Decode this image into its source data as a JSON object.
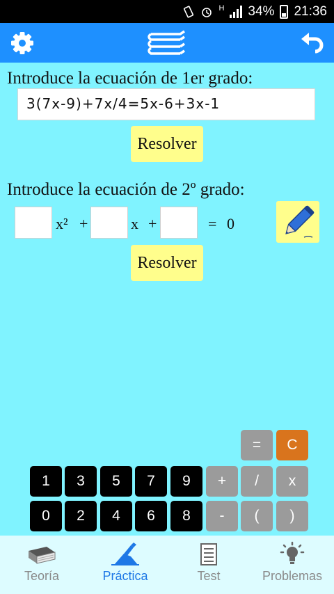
{
  "status_bar": {
    "battery": "34%",
    "time": "21:36",
    "network": "H"
  },
  "app_bar": {
    "settings_icon": "gear-icon",
    "center_icon": "books-icon",
    "back_icon": "undo-arrow-icon",
    "color": "#1e90ff"
  },
  "first_degree": {
    "label": "Introduce la ecuación de 1er grado:",
    "equation": "3(7x-9)+7x/4=5x-6+3x-1",
    "button": "Resolver"
  },
  "second_degree": {
    "label": "Introduce la ecuación de 2º grado:",
    "coef_a": "",
    "coef_b": "",
    "coef_c": "",
    "term_x2": "x²",
    "plus_1": "+",
    "term_x": "x",
    "plus_2": "+",
    "equals": "=",
    "zero": "0",
    "pencil_icon": "pencil-icon",
    "button": "Resolver"
  },
  "keypad": {
    "top_row": [
      "=",
      "C"
    ],
    "row1": [
      "1",
      "3",
      "5",
      "7",
      "9",
      "+",
      "/",
      "x"
    ],
    "row2": [
      "0",
      "2",
      "4",
      "6",
      "8",
      "-",
      "(",
      ")"
    ]
  },
  "bottom_nav": {
    "items": [
      {
        "label": "Teoría",
        "icon": "book-icon"
      },
      {
        "label": "Práctica",
        "icon": "pen-hand-icon"
      },
      {
        "label": "Test",
        "icon": "checklist-icon"
      },
      {
        "label": "Problemas",
        "icon": "lightbulb-icon"
      }
    ],
    "active": "Práctica"
  },
  "colors": {
    "background": "#80f3ff",
    "button": "#fffe8c",
    "accent": "#1e90ff",
    "clear_key": "#d9741d"
  }
}
